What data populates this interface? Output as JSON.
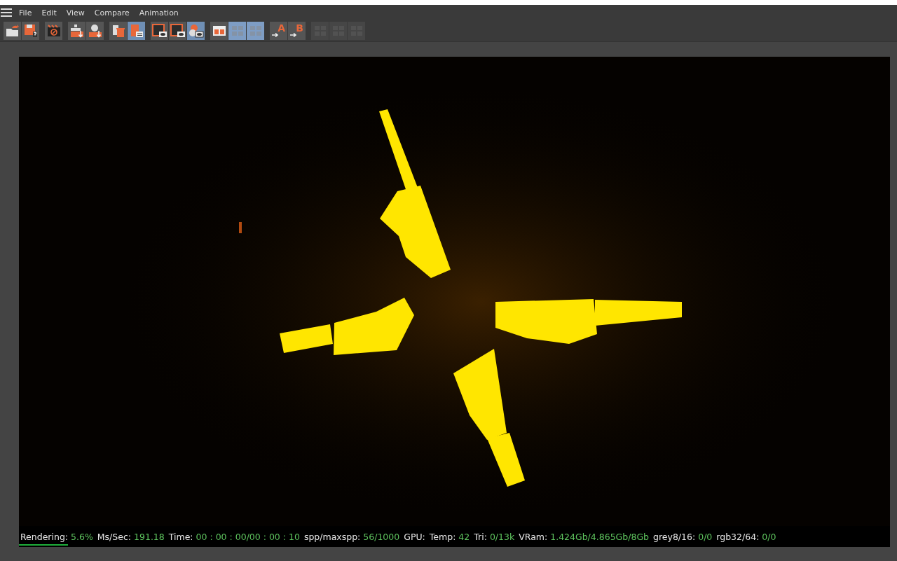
{
  "menu": [
    "File",
    "Edit",
    "View",
    "Compare",
    "Animation"
  ],
  "toolbar": [
    [
      {
        "kind": "open",
        "selected": false,
        "disabled": false
      },
      {
        "kind": "save",
        "selected": false,
        "disabled": false
      }
    ],
    [
      {
        "kind": "clapper",
        "selected": false,
        "disabled": false
      }
    ],
    [
      {
        "kind": "add-down",
        "selected": false,
        "disabled": false
      },
      {
        "kind": "sphere-down",
        "selected": false,
        "disabled": false
      }
    ],
    [
      {
        "kind": "trash",
        "selected": false,
        "disabled": false
      },
      {
        "kind": "notes",
        "selected": true,
        "disabled": false
      }
    ],
    [
      {
        "kind": "frame-eye",
        "selected": false,
        "disabled": false
      },
      {
        "kind": "frame-eye",
        "selected": false,
        "disabled": false
      },
      {
        "kind": "shapes-eye",
        "selected": true,
        "disabled": false
      }
    ],
    [
      {
        "kind": "ab",
        "selected": false,
        "disabled": false
      },
      {
        "kind": "ab-grid",
        "selected": true,
        "disabled": true
      },
      {
        "kind": "ab-grid",
        "selected": true,
        "disabled": true
      }
    ],
    [
      {
        "kind": "letter",
        "label": "A",
        "selected": false,
        "disabled": false
      },
      {
        "kind": "letter",
        "label": "B",
        "selected": false,
        "disabled": false
      }
    ],
    [
      {
        "kind": "ab-grid",
        "selected": false,
        "disabled": true
      },
      {
        "kind": "ab-grid",
        "selected": false,
        "disabled": true
      },
      {
        "kind": "ab-grid",
        "selected": false,
        "disabled": true
      }
    ]
  ],
  "status_bar": {
    "progress": {
      "level": 0.056
    },
    "items": [
      {
        "label": "Rendering:",
        "value": "5.6%"
      },
      {
        "label": "Ms/Sec:",
        "value": "191.18"
      },
      {
        "label": "Time:",
        "value": "00 : 00 : 00/00 : 00 : 10"
      },
      {
        "label": "spp/maxspp:",
        "value": "56/1000"
      },
      {
        "label": "GPU:"
      },
      {
        "label": "Temp:",
        "value": "42"
      },
      {
        "label": "Tri:",
        "value": "0/13k"
      },
      {
        "label": "VRam:",
        "value": "1.424Gb/4.865Gb/8Gb"
      },
      {
        "label": "grey8/16:",
        "value": "0/0"
      },
      {
        "label": "rgb32/64:",
        "value": "0/0"
      }
    ]
  }
}
